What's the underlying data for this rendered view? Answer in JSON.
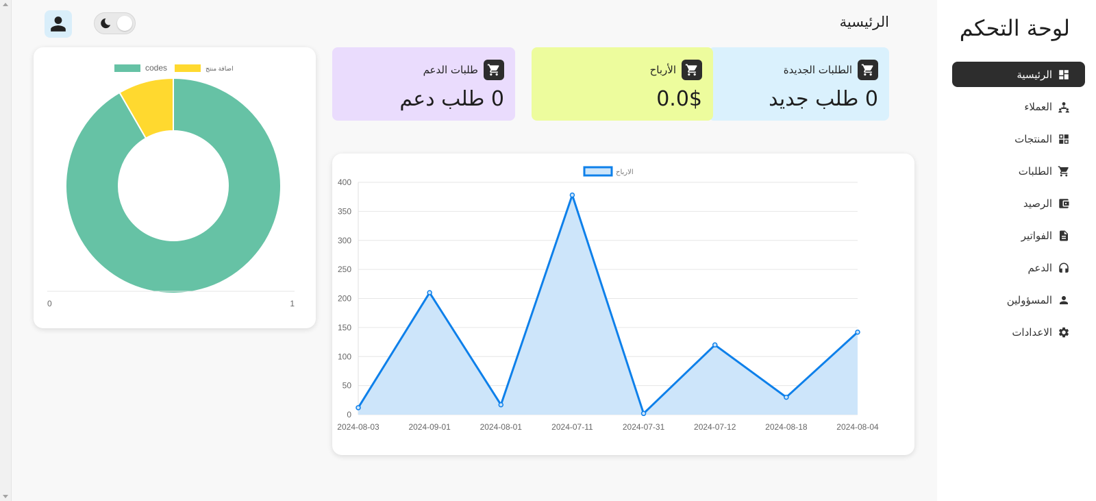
{
  "sidebar": {
    "title": "لوحة التحكم",
    "items": [
      {
        "label": "الرئيسية",
        "icon": "dashboard-icon",
        "active": true
      },
      {
        "label": "العملاء",
        "icon": "customers-icon",
        "active": false
      },
      {
        "label": "المنتجات",
        "icon": "products-icon",
        "active": false
      },
      {
        "label": "الطلبات",
        "icon": "cart-icon",
        "active": false
      },
      {
        "label": "الرصيد",
        "icon": "wallet-icon",
        "active": false
      },
      {
        "label": "الفواتير",
        "icon": "invoice-icon",
        "active": false
      },
      {
        "label": "الدعم",
        "icon": "headset-icon",
        "active": false
      },
      {
        "label": "المسؤولين",
        "icon": "user-icon",
        "active": false
      },
      {
        "label": "الاعدادات",
        "icon": "gear-icon",
        "active": false
      }
    ]
  },
  "header": {
    "title": "الرئيسية",
    "avatar_icon": "user-avatar-icon",
    "theme_toggle_icon": "moon-icon"
  },
  "cards": [
    {
      "title": "الطلبات الجديدة",
      "value": "0 طلب جديد",
      "icon": "cart-icon",
      "color": "#daf1fd"
    },
    {
      "title": "الأرباح",
      "value": "0.0$",
      "icon": "cart-icon",
      "color": "#edfc9d"
    },
    {
      "title": "طلبات الدعم",
      "value": "0 طلب دعم",
      "icon": "cart-icon",
      "color": "#eadcfd"
    }
  ],
  "chart_data": [
    {
      "type": "pie",
      "subtype": "doughnut",
      "labels": [
        "codes",
        "اضافة منتج"
      ],
      "values": [
        11,
        1
      ],
      "colors": [
        "#66c2a5",
        "#ffd92f"
      ],
      "legend": "top",
      "x_ticks": [
        "0",
        "1"
      ]
    },
    {
      "type": "area",
      "categories": [
        "2024-08-03",
        "2024-09-01",
        "2024-08-01",
        "2024-07-11",
        "2024-07-31",
        "2024-07-12",
        "2024-08-18",
        "2024-08-04"
      ],
      "series": [
        {
          "name": "الارباح",
          "values": [
            12,
            210,
            17,
            378,
            2,
            120,
            30,
            142
          ]
        }
      ],
      "y_ticks": [
        "0",
        "50",
        "100",
        "150",
        "200",
        "250",
        "300",
        "350",
        "400"
      ],
      "ylim": [
        0,
        400
      ],
      "grid": true,
      "legend": "top",
      "line_color": "#0e80ea",
      "fill_color": "#cde5fa"
    }
  ]
}
